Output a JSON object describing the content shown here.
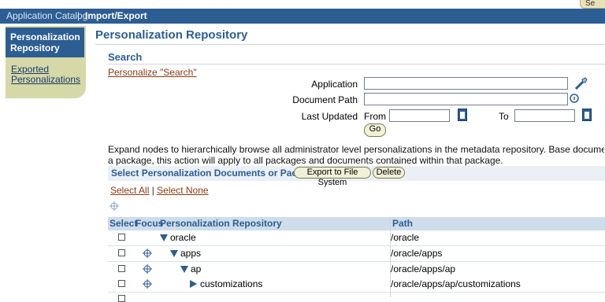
{
  "top_strip": {
    "tab_label": "Se"
  },
  "global_nav": {
    "item1": "Application Catalog",
    "separator": "|",
    "item2": "Import/Export"
  },
  "sidebar": {
    "items": [
      {
        "label": "Personalization Repository"
      },
      {
        "label": "Exported Personalizations"
      }
    ]
  },
  "page": {
    "title": "Personalization Repository",
    "search_heading": "Search",
    "personalize_link": "Personalize \"Search\""
  },
  "search_form": {
    "application_label": "Application",
    "application_value": "",
    "document_path_label": "Document Path",
    "document_path_value": "",
    "last_updated_label": "Last Updated",
    "from_label": "From",
    "from_value": "",
    "to_label": "To",
    "to_value": "",
    "go_label": "Go"
  },
  "description": {
    "line1": "Expand nodes to hierarchically browse all administrator level personalizations in the metadata repository. Base documents will not appear in",
    "line2": "a package, this action will apply to all packages and documents contained within that package."
  },
  "selection_bar": {
    "label": "Select Personalization Documents or Package:",
    "export_label": "Export to File System",
    "delete_label": "Delete",
    "select_all": "Select All",
    "select_sep": "|",
    "select_none": "Select None"
  },
  "table": {
    "headers": {
      "select": "Select",
      "focus": "Focus",
      "repo": "Personalization Repository",
      "path": "Path"
    },
    "rows": [
      {
        "name": "oracle",
        "path": "/oracle"
      },
      {
        "name": "apps",
        "path": "/oracle/apps"
      },
      {
        "name": "ap",
        "path": "/oracle/apps/ap"
      },
      {
        "name": "customizations",
        "path": "/oracle/apps/ap/customizations"
      }
    ]
  },
  "colors": {
    "brand_blue": "#2c5d93",
    "sidebar_tan": "#d7d8a8",
    "link_brown": "#8a3b12"
  }
}
